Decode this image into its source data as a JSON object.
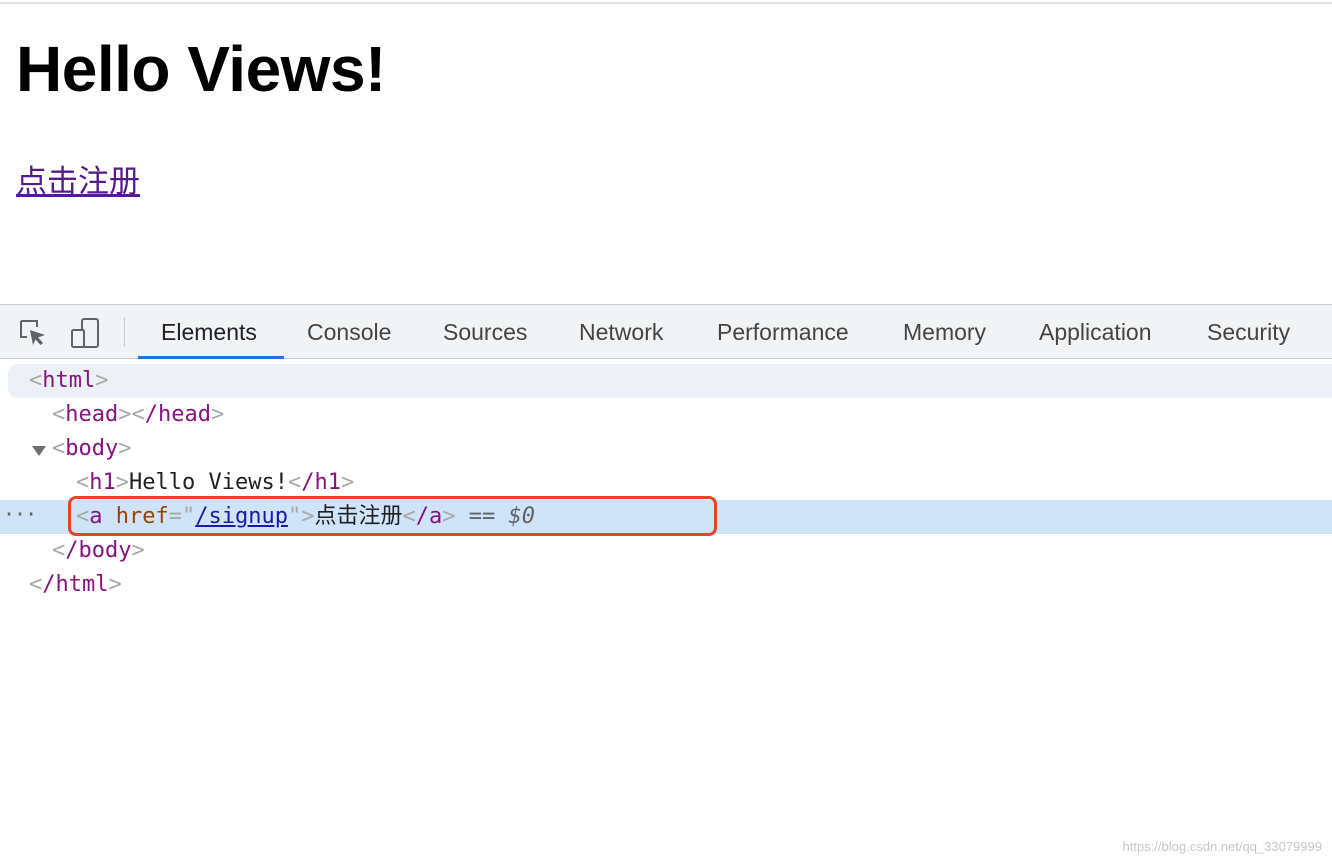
{
  "page": {
    "heading": "Hello Views!",
    "link_text": "点击注册"
  },
  "devtools": {
    "tools": [
      {
        "name": "inspect-element-icon"
      },
      {
        "name": "device-toolbar-icon"
      }
    ],
    "tabs": [
      {
        "label": "Elements",
        "active": true
      },
      {
        "label": "Console"
      },
      {
        "label": "Sources"
      },
      {
        "label": "Network"
      },
      {
        "label": "Performance"
      },
      {
        "label": "Memory"
      },
      {
        "label": "Application"
      },
      {
        "label": "Security"
      }
    ],
    "dom": {
      "html_open": "html",
      "head_open": "head",
      "head_close": "/head",
      "body_open": "body",
      "h1_open": "h1",
      "h1_text": "Hello Views!",
      "h1_close": "/h1",
      "a_open": "a",
      "a_attr_name": "href",
      "a_attr_value": "/signup",
      "a_text": "点击注册",
      "a_close": "/a",
      "selected_marker": "== ",
      "selected_ref": "$0",
      "body_close": "/body",
      "html_close": "/html",
      "row_ellipsis": "···"
    },
    "accent_color": "#1a73e8",
    "highlight_color": "#e8432a"
  },
  "watermark": "https://blog.csdn.net/qq_33079999"
}
